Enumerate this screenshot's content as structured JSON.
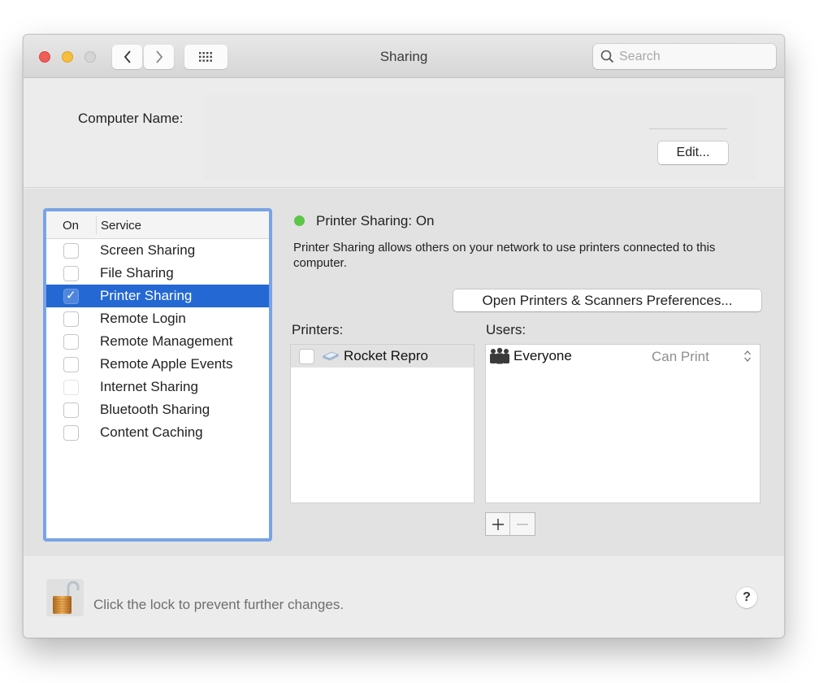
{
  "window": {
    "title": "Sharing",
    "search": {
      "placeholder": "Search",
      "value": ""
    }
  },
  "computer_name": {
    "label": "Computer Name:",
    "value": "",
    "edit_button": "Edit..."
  },
  "services": {
    "header_on": "On",
    "header_service": "Service",
    "items": [
      {
        "label": "Screen Sharing",
        "on": false,
        "selected": false,
        "enabled": true
      },
      {
        "label": "File Sharing",
        "on": false,
        "selected": false,
        "enabled": true
      },
      {
        "label": "Printer Sharing",
        "on": true,
        "selected": true,
        "enabled": true
      },
      {
        "label": "Remote Login",
        "on": false,
        "selected": false,
        "enabled": true
      },
      {
        "label": "Remote Management",
        "on": false,
        "selected": false,
        "enabled": true
      },
      {
        "label": "Remote Apple Events",
        "on": false,
        "selected": false,
        "enabled": true
      },
      {
        "label": "Internet Sharing",
        "on": false,
        "selected": false,
        "enabled": false
      },
      {
        "label": "Bluetooth Sharing",
        "on": false,
        "selected": false,
        "enabled": true
      },
      {
        "label": "Content Caching",
        "on": false,
        "selected": false,
        "enabled": true
      }
    ]
  },
  "detail": {
    "status_title": "Printer Sharing: On",
    "status_color": "#5bc649",
    "description": "Printer Sharing allows others on your network to use printers connected to this computer.",
    "open_prefs_button": "Open Printers & Scanners Preferences...",
    "printers_label": "Printers:",
    "users_label": "Users:",
    "printers": [
      {
        "label": "Rocket Repro",
        "checked": false,
        "icon": "printer-icon"
      }
    ],
    "users": [
      {
        "label": "Everyone",
        "permission": "Can Print",
        "icon": "group-icon"
      }
    ],
    "add_symbol": "+",
    "remove_symbol": "—"
  },
  "footer": {
    "lock_text": "Click the lock to prevent further changes.",
    "lock_icon": "unlocked-padlock-icon",
    "help_symbol": "?"
  },
  "colors": {
    "selection": "#2468d3",
    "focus_ring": "#79a3e6",
    "close": "#ee5e57",
    "minimize": "#f6be3b"
  }
}
